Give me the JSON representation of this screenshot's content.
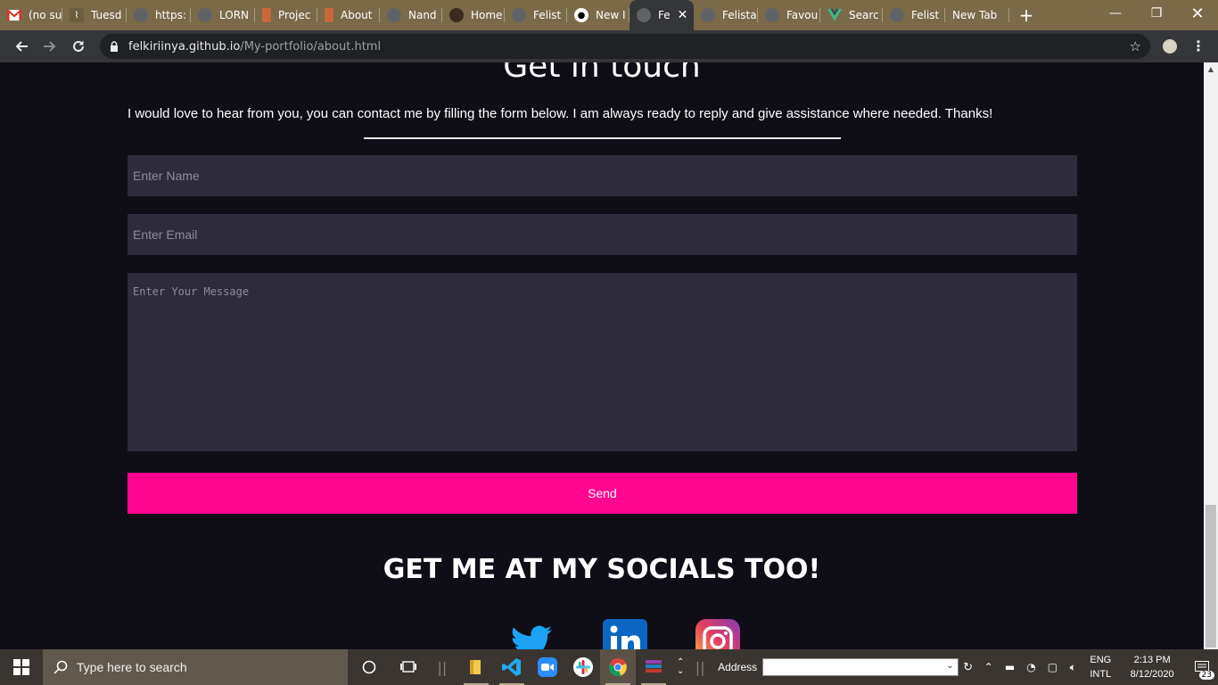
{
  "browser": {
    "tabs": [
      {
        "title": "(no su",
        "icon": "gmail-icon"
      },
      {
        "title": "Tuesd",
        "icon": "palm-icon"
      },
      {
        "title": "https:",
        "icon": "globe-icon"
      },
      {
        "title": "LORN",
        "icon": "globe-icon"
      },
      {
        "title": "Projec",
        "icon": "doc-icon"
      },
      {
        "title": "About",
        "icon": "doc-icon"
      },
      {
        "title": "Nand",
        "icon": "globe-icon"
      },
      {
        "title": "Home",
        "icon": "avatar-icon"
      },
      {
        "title": "Felist",
        "icon": "globe-icon"
      },
      {
        "title": "New I",
        "icon": "github-icon"
      },
      {
        "title": "Fe",
        "icon": "globe-icon",
        "active": true
      },
      {
        "title": "Felista",
        "icon": "globe-icon"
      },
      {
        "title": "Favou",
        "icon": "globe-icon"
      },
      {
        "title": "Searc",
        "icon": "vue-icon"
      },
      {
        "title": "Felist",
        "icon": "globe-icon"
      },
      {
        "title": "New Tab",
        "icon": ""
      }
    ],
    "url_host": "felkiriinya.github.io",
    "url_path": "/My-portfolio/about.html"
  },
  "page": {
    "heading": "Get in touch",
    "intro": "I would love to hear from you, you can contact me by filling the form below. I am always ready to reply and give assistance where needed. Thanks!",
    "form": {
      "name_placeholder": "Enter Name",
      "email_placeholder": "Enter Email",
      "message_placeholder": "Enter Your Message",
      "send_label": "Send"
    },
    "socials_title": "GET ME AT MY SOCIALS TOO!",
    "socials": [
      "twitter-icon",
      "linkedin-icon",
      "instagram-icon"
    ],
    "colors": {
      "background": "#0f0e17",
      "field": "#2e2b3b",
      "button": "#ff0590",
      "text": "#fffffe"
    }
  },
  "taskbar": {
    "search_placeholder": "Type here to search",
    "address_label": "Address",
    "lang_top": "ENG",
    "lang_bottom": "INTL",
    "time": "2:13 PM",
    "date": "8/12/2020",
    "notifications": "23"
  }
}
